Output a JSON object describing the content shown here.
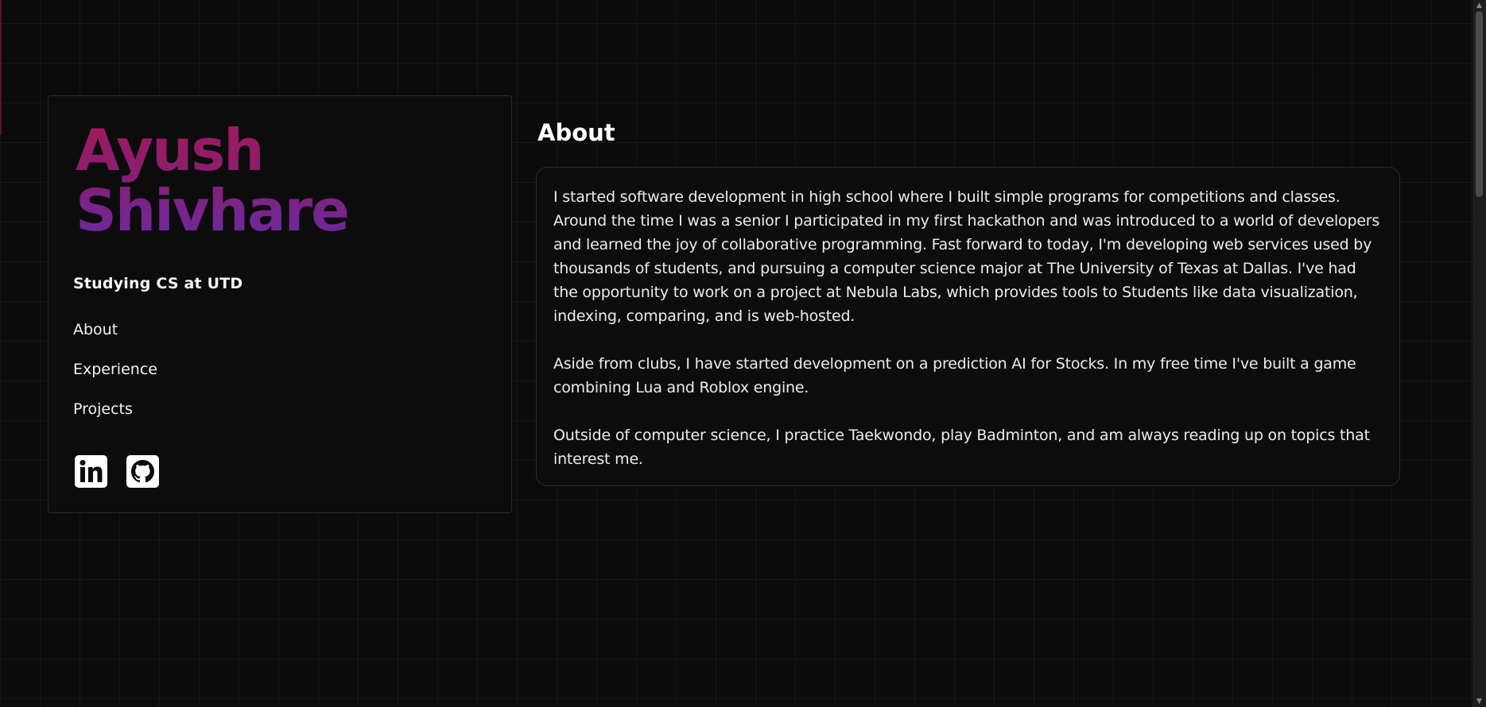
{
  "profile": {
    "first_name": "Ayush",
    "last_name": "Shivhare",
    "tagline": "Studying CS at UTD"
  },
  "nav": {
    "items": [
      {
        "label": "About"
      },
      {
        "label": "Experience"
      },
      {
        "label": "Projects"
      }
    ]
  },
  "socials": {
    "icons": [
      "linkedin-icon",
      "github-icon"
    ]
  },
  "about": {
    "title": "About",
    "paragraphs": [
      "I started software development in high school where I built simple programs for competitions and classes. Around the time I was a senior I participated in my first hackathon and was introduced to a world of developers and learned the joy of collaborative programming. Fast forward to today, I'm developing web services used by thousands of students, and pursuing a computer science major at The University of Texas at Dallas. I've had the opportunity to work on a project at Nebula Labs, which provides tools to Students like data visualization, indexing, comparing, and is web-hosted.",
      "Aside from clubs, I have started development on a prediction AI for Stocks. In my free time I've built a game combining Lua and Roblox engine.",
      "Outside of computer science, I practice Taekwondo, play Badminton, and am always reading up on topics that interest me."
    ]
  },
  "colors": {
    "background": "#0c0b0b",
    "name_gradient_top": "#a11a5a",
    "name_gradient_bottom": "#6a2aa0",
    "text": "#ffffff"
  }
}
